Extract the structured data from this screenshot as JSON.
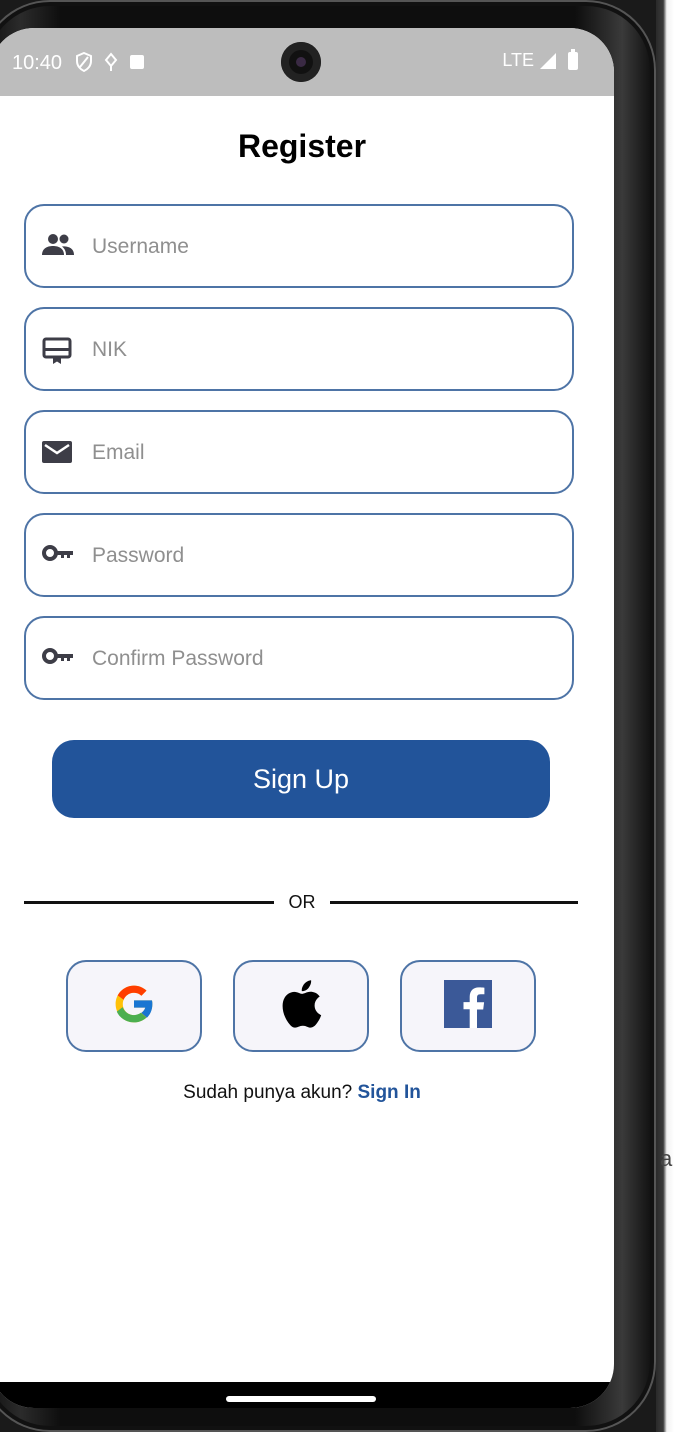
{
  "status_bar": {
    "time": "10:40",
    "network": "LTE"
  },
  "page": {
    "title": "Register"
  },
  "fields": [
    {
      "placeholder": "Username",
      "icon": "group-icon"
    },
    {
      "placeholder": "NIK",
      "icon": "id-card-icon"
    },
    {
      "placeholder": "Email",
      "icon": "mail-icon"
    },
    {
      "placeholder": "Password",
      "icon": "key-icon"
    },
    {
      "placeholder": "Confirm Password",
      "icon": "key-icon"
    }
  ],
  "actions": {
    "signup_label": "Sign Up"
  },
  "divider": {
    "label": "OR"
  },
  "social": [
    {
      "icon": "google-icon"
    },
    {
      "icon": "apple-icon"
    },
    {
      "icon": "facebook-icon"
    }
  ],
  "footer": {
    "prompt": "Sudah punya akun?",
    "link": "Sign In"
  },
  "colors": {
    "primary": "#22549A",
    "field_border": "#4E74A6",
    "status_bar": "#BDBDBD",
    "social_bg": "#F6F5FA"
  }
}
